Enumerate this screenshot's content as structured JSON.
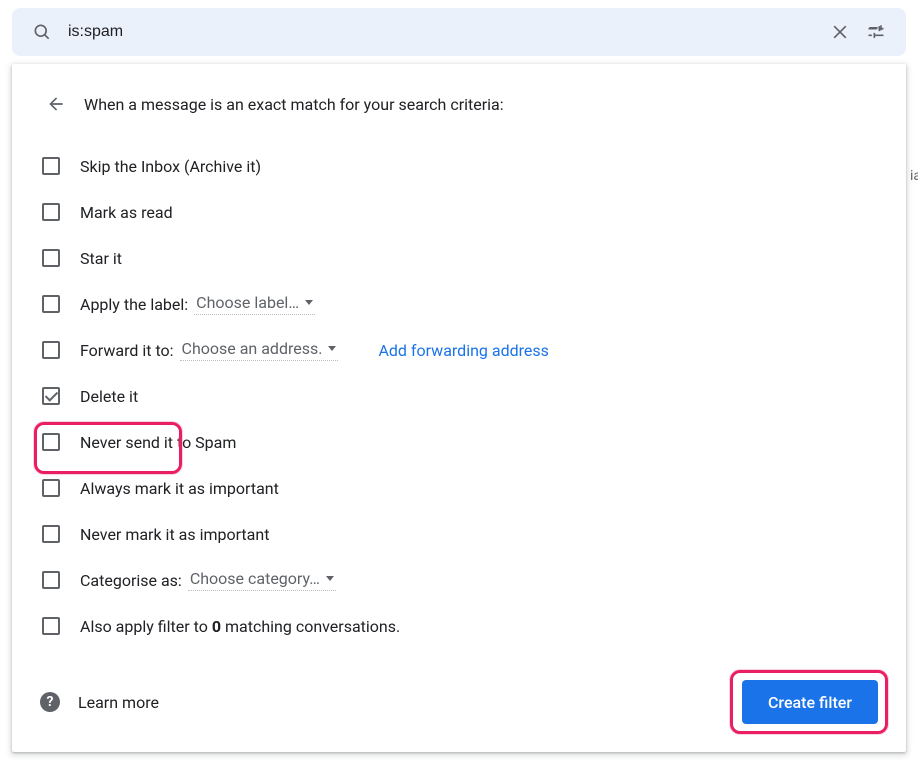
{
  "search": {
    "value": "is:spam"
  },
  "panel": {
    "title": "When a message is an exact match for your search criteria:",
    "learn_more": "Learn more",
    "create_button": "Create filter",
    "add_forwarding_link": "Add forwarding address"
  },
  "filters": [
    {
      "label": "Skip the Inbox (Archive it)",
      "checked": false
    },
    {
      "label": "Mark as read",
      "checked": false
    },
    {
      "label": "Star it",
      "checked": false
    },
    {
      "label": "Apply the label:",
      "checked": false,
      "dropdown": "Choose label…"
    },
    {
      "label": "Forward it to:",
      "checked": false,
      "dropdown": "Choose an address."
    },
    {
      "label": "Delete it",
      "checked": true
    },
    {
      "label": "Never send it to Spam",
      "checked": false
    },
    {
      "label": "Always mark it as important",
      "checked": false
    },
    {
      "label": "Never mark it as important",
      "checked": false
    },
    {
      "label": "Categorise as:",
      "checked": false,
      "dropdown": "Choose category…"
    },
    {
      "label_pre": "Also apply filter to ",
      "label_bold": "0",
      "label_post": " matching conversations.",
      "checked": false
    }
  ]
}
